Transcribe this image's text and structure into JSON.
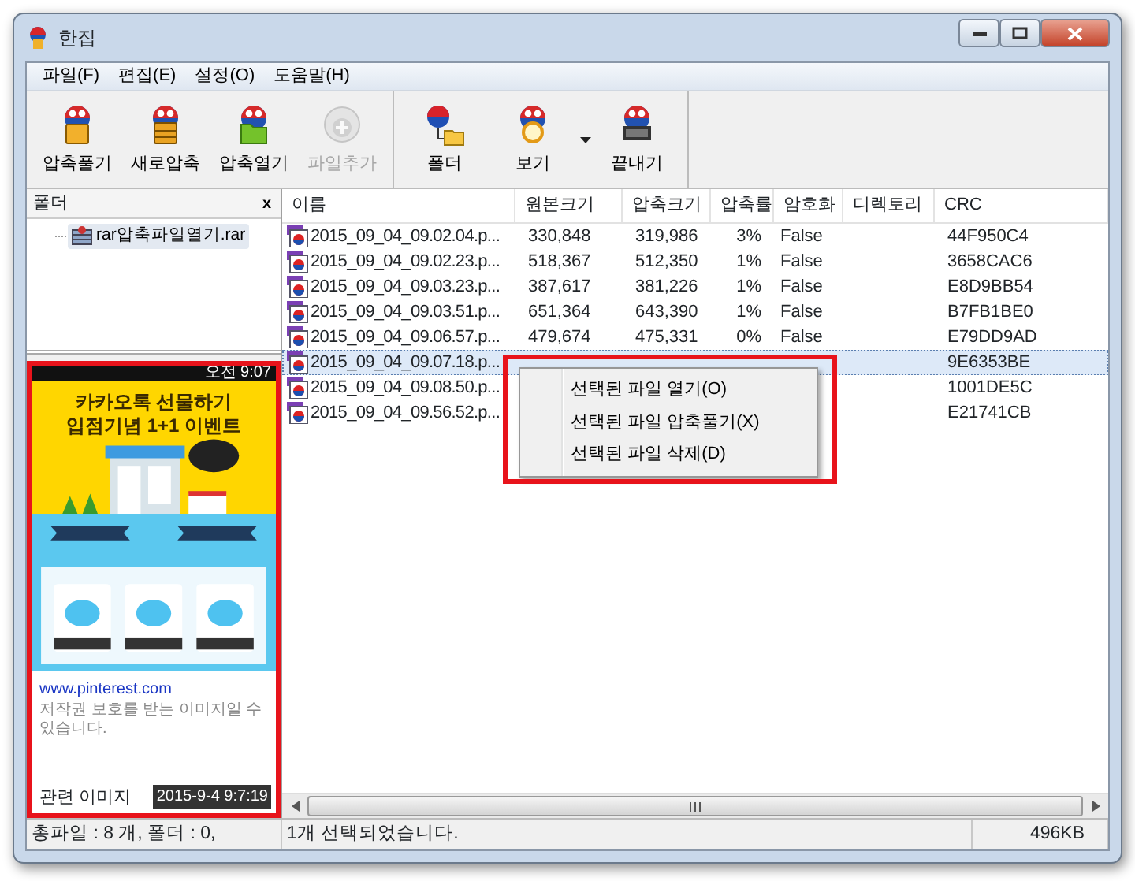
{
  "window": {
    "title": "한집"
  },
  "menu": [
    "파일(F)",
    "편집(E)",
    "설정(O)",
    "도움말(H)"
  ],
  "toolbar": [
    [
      {
        "label": "압축풀기",
        "kind": "extract",
        "disabled": false,
        "dropdown": false
      },
      {
        "label": "새로압축",
        "kind": "new",
        "disabled": false,
        "dropdown": false
      },
      {
        "label": "압축열기",
        "kind": "open",
        "disabled": false,
        "dropdown": false
      },
      {
        "label": "파일추가",
        "kind": "add",
        "disabled": true,
        "dropdown": false
      }
    ],
    [
      {
        "label": "폴더",
        "kind": "folder",
        "disabled": false,
        "dropdown": false
      },
      {
        "label": "보기",
        "kind": "view",
        "disabled": false,
        "dropdown": true
      },
      {
        "label": "끝내기",
        "kind": "exit",
        "disabled": false,
        "dropdown": false
      }
    ]
  ],
  "folder_pane": {
    "title": "폴더",
    "close": "x",
    "items": [
      {
        "label": "rar압축파일열기.rar",
        "selected": true
      }
    ]
  },
  "preview": {
    "highlight": true,
    "phone_status": "오전 9:07",
    "headline": [
      "카카오톡 선물하기",
      "입점기념 1+1 이벤트"
    ],
    "link": "www.pinterest.com",
    "caption": "저작권 보호를 받는 이미지일 수 있습니다.",
    "related": "관련 이미지",
    "timestamp": "2015-9-4 9:7:19"
  },
  "table": {
    "columns": [
      "이름",
      "원본크기",
      "압축크기",
      "압축률",
      "암호화",
      "디렉토리",
      "CRC"
    ],
    "rows": [
      {
        "name": "2015_09_04_09.02.04.p...",
        "original": "330,848",
        "compressed": "319,986",
        "ratio": "3%",
        "encrypted": "False",
        "crc": "44F950C4",
        "selected": false
      },
      {
        "name": "2015_09_04_09.02.23.p...",
        "original": "518,367",
        "compressed": "512,350",
        "ratio": "1%",
        "encrypted": "False",
        "crc": "3658CAC6",
        "selected": false
      },
      {
        "name": "2015_09_04_09.03.23.p...",
        "original": "387,617",
        "compressed": "381,226",
        "ratio": "1%",
        "encrypted": "False",
        "crc": "E8D9BB54",
        "selected": false
      },
      {
        "name": "2015_09_04_09.03.51.p...",
        "original": "651,364",
        "compressed": "643,390",
        "ratio": "1%",
        "encrypted": "False",
        "crc": "B7FB1BE0",
        "selected": false
      },
      {
        "name": "2015_09_04_09.06.57.p...",
        "original": "479,674",
        "compressed": "475,331",
        "ratio": "0%",
        "encrypted": "False",
        "crc": "E79DD9AD",
        "selected": false
      },
      {
        "name": "2015_09_04_09.07.18.p...",
        "crc": "9E6353BE",
        "selected": true
      },
      {
        "name": "2015_09_04_09.08.50.p...",
        "crc": "1001DE5C",
        "selected": false
      },
      {
        "name": "2015_09_04_09.56.52.p...",
        "crc": "E21741CB",
        "selected": false
      }
    ]
  },
  "context_menu": {
    "highlight": true,
    "items": [
      "선택된 파일 열기(O)",
      "선택된 파일 압축풀기(X)",
      "선택된 파일 삭제(D)"
    ]
  },
  "status_bar": {
    "files": "총파일 : 8 개, 폴더 : 0,",
    "selection": "1개 선택되었습니다.",
    "size": "496KB"
  }
}
